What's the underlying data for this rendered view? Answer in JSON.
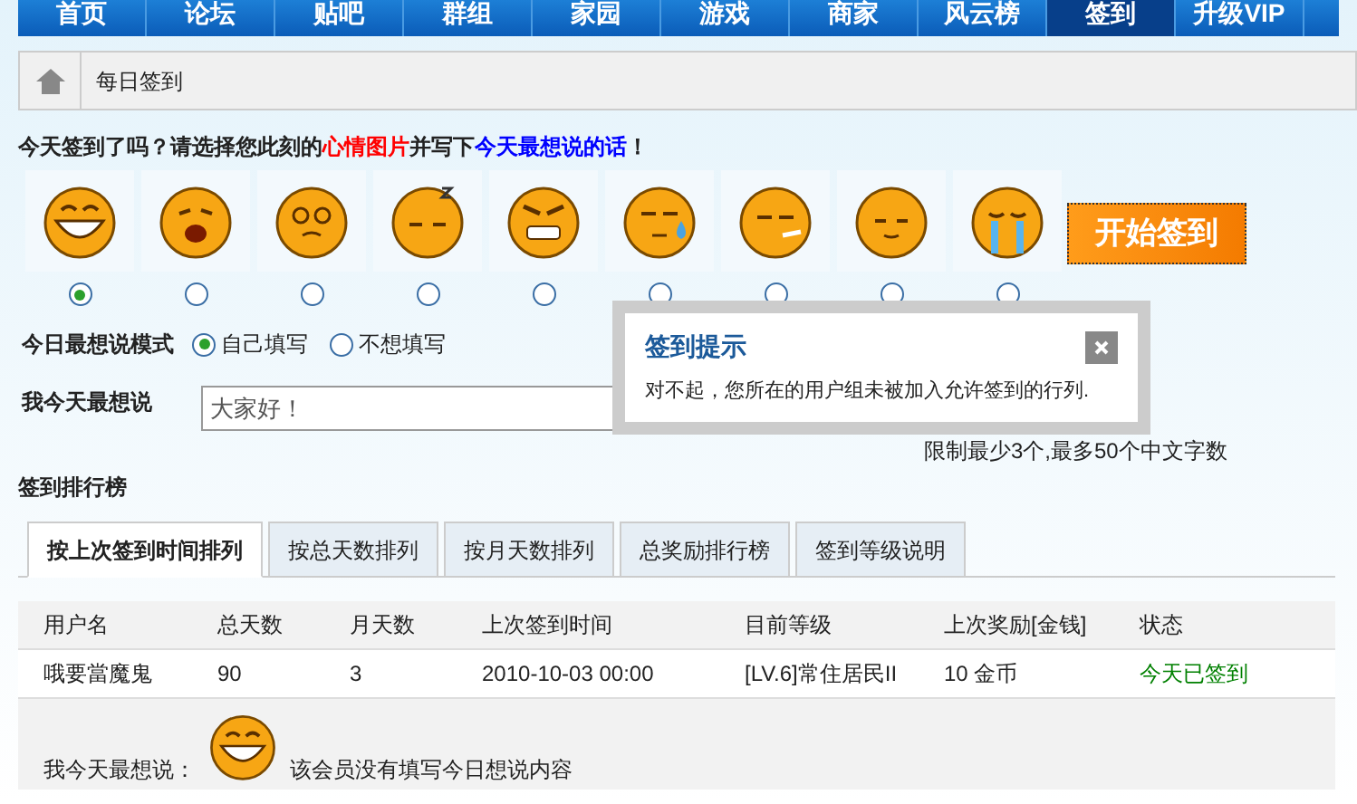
{
  "nav": [
    {
      "label": "首页",
      "selected": false
    },
    {
      "label": "论坛",
      "selected": false
    },
    {
      "label": "贴吧",
      "selected": false
    },
    {
      "label": "群组",
      "selected": false
    },
    {
      "label": "家园",
      "selected": false
    },
    {
      "label": "游戏",
      "selected": false
    },
    {
      "label": "商家",
      "selected": false
    },
    {
      "label": "风云榜",
      "selected": false
    },
    {
      "label": "签到",
      "selected": true
    },
    {
      "label": "升级VIP",
      "selected": false
    }
  ],
  "breadcrumb": "每日签到",
  "prompt": [
    {
      "text": "今天签到了吗？请选择您此刻的",
      "color": "#222222"
    },
    {
      "text": "心情图片",
      "color": "#ff0000"
    },
    {
      "text": "并写下",
      "color": "#222222"
    },
    {
      "text": "今天最想说的话",
      "color": "#0000ff"
    },
    {
      "text": "！",
      "color": "#222222"
    }
  ],
  "moods": [
    {
      "kind": "grin",
      "selected": true
    },
    {
      "kind": "sad",
      "selected": false
    },
    {
      "kind": "dizzy",
      "selected": false
    },
    {
      "kind": "sleepy",
      "selected": false
    },
    {
      "kind": "angry",
      "selected": false
    },
    {
      "kind": "sweat",
      "selected": false
    },
    {
      "kind": "smoke",
      "selected": false
    },
    {
      "kind": "smug",
      "selected": false
    },
    {
      "kind": "cry",
      "selected": false
    }
  ],
  "start_button": "开始签到",
  "mode": {
    "label": "今日最想说模式",
    "options": [
      {
        "label": "自己填写",
        "selected": true
      },
      {
        "label": "不想填写",
        "selected": false
      }
    ]
  },
  "say": {
    "label": "我今天最想说",
    "value": "大家好！",
    "hint": "限制最少3个,最多50个中文字数"
  },
  "ranking": {
    "title": "签到排行榜",
    "tabs": [
      {
        "label": "按上次签到时间排列",
        "selected": true
      },
      {
        "label": "按总天数排列",
        "selected": false
      },
      {
        "label": "按月天数排列",
        "selected": false
      },
      {
        "label": "总奖励排行榜",
        "selected": false
      },
      {
        "label": "签到等级说明",
        "selected": false
      }
    ],
    "columns": [
      "用户名",
      "总天数",
      "月天数",
      "上次签到时间",
      "目前等级",
      "上次奖励[金钱]",
      "状态"
    ],
    "rows": [
      {
        "cells": [
          "哦要當魔鬼",
          "90",
          "3",
          "2010-10-03 00:00",
          "[LV.6]常住居民II",
          "10 金币",
          "今天已签到"
        ],
        "color": "#008000"
      }
    ],
    "detail": {
      "label": "我今天最想说：",
      "mood": {
        "kind": "grin"
      },
      "text": "该会员没有填写今日想说内容"
    }
  },
  "dialog": {
    "title": "签到提示",
    "message": "对不起，您所在的用户组未被加入允许签到的行列."
  }
}
